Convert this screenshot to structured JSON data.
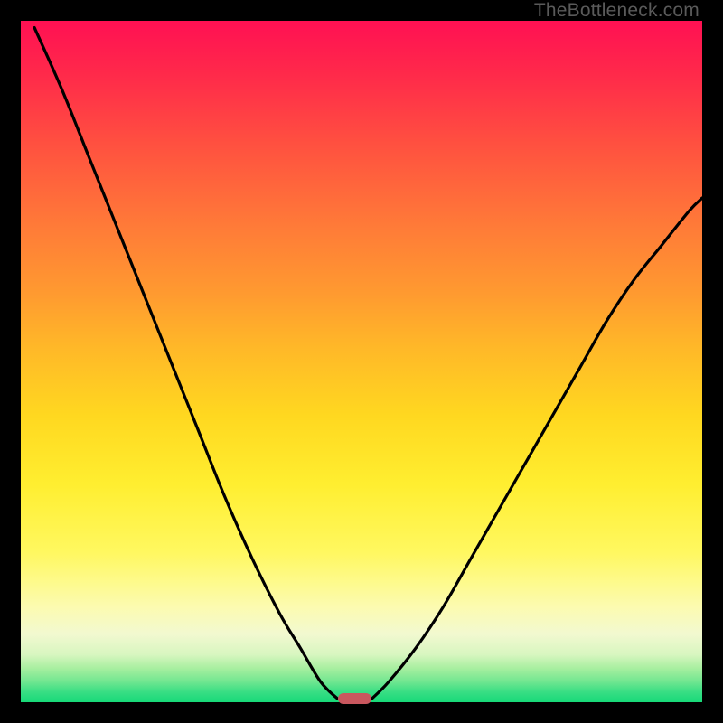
{
  "watermark": "TheBottleneck.com",
  "chart_data": {
    "type": "line",
    "title": "",
    "xlabel": "",
    "ylabel": "",
    "xlim": [
      0,
      100
    ],
    "ylim": [
      0,
      100
    ],
    "grid": false,
    "legend": false,
    "series": [
      {
        "name": "left-curve",
        "x": [
          2,
          6,
          10,
          14,
          18,
          22,
          26,
          30,
          34,
          38,
          41,
          44,
          46.5
        ],
        "values": [
          99,
          90,
          80,
          70,
          60,
          50,
          40,
          30,
          21,
          13,
          8,
          3,
          0.5
        ]
      },
      {
        "name": "right-curve",
        "x": [
          51.5,
          54,
          58,
          62,
          66,
          70,
          74,
          78,
          82,
          86,
          90,
          94,
          98,
          100
        ],
        "values": [
          0.5,
          3,
          8,
          14,
          21,
          28,
          35,
          42,
          49,
          56,
          62,
          67,
          72,
          74
        ]
      }
    ],
    "marker": {
      "name": "bottleneck-marker",
      "x_center": 49,
      "width_pct": 5,
      "color": "#c9575e"
    },
    "gradient_stops": [
      {
        "pos": 0,
        "color": "#ff1053"
      },
      {
        "pos": 50,
        "color": "#ffb828"
      },
      {
        "pos": 80,
        "color": "#fff860"
      },
      {
        "pos": 100,
        "color": "#17d978"
      }
    ]
  }
}
